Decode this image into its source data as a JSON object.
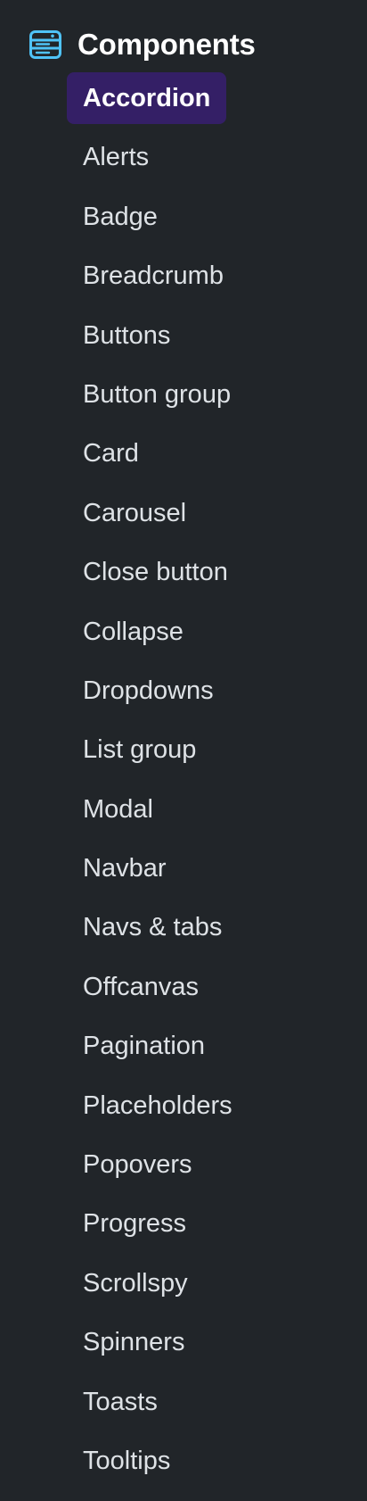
{
  "section": {
    "title": "Components",
    "icon": "components-icon",
    "accent_color": "#4fc3f7"
  },
  "colors": {
    "background": "#212529",
    "active_background": "#341f66",
    "text": "#dee2e6",
    "active_text": "#ffffff"
  },
  "nav": {
    "active_index": 0,
    "items": [
      {
        "label": "Accordion"
      },
      {
        "label": "Alerts"
      },
      {
        "label": "Badge"
      },
      {
        "label": "Breadcrumb"
      },
      {
        "label": "Buttons"
      },
      {
        "label": "Button group"
      },
      {
        "label": "Card"
      },
      {
        "label": "Carousel"
      },
      {
        "label": "Close button"
      },
      {
        "label": "Collapse"
      },
      {
        "label": "Dropdowns"
      },
      {
        "label": "List group"
      },
      {
        "label": "Modal"
      },
      {
        "label": "Navbar"
      },
      {
        "label": "Navs & tabs"
      },
      {
        "label": "Offcanvas"
      },
      {
        "label": "Pagination"
      },
      {
        "label": "Placeholders"
      },
      {
        "label": "Popovers"
      },
      {
        "label": "Progress"
      },
      {
        "label": "Scrollspy"
      },
      {
        "label": "Spinners"
      },
      {
        "label": "Toasts"
      },
      {
        "label": "Tooltips"
      }
    ]
  }
}
